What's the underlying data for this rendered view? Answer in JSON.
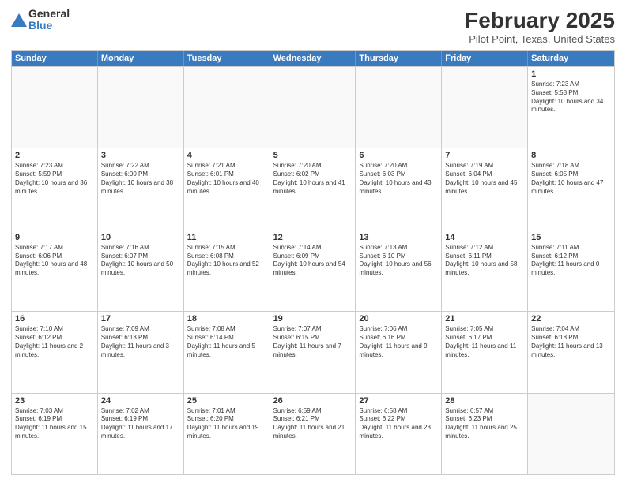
{
  "header": {
    "logo_general": "General",
    "logo_blue": "Blue",
    "month": "February 2025",
    "location": "Pilot Point, Texas, United States"
  },
  "weekdays": [
    "Sunday",
    "Monday",
    "Tuesday",
    "Wednesday",
    "Thursday",
    "Friday",
    "Saturday"
  ],
  "weeks": [
    [
      {
        "day": "",
        "text": ""
      },
      {
        "day": "",
        "text": ""
      },
      {
        "day": "",
        "text": ""
      },
      {
        "day": "",
        "text": ""
      },
      {
        "day": "",
        "text": ""
      },
      {
        "day": "",
        "text": ""
      },
      {
        "day": "1",
        "text": "Sunrise: 7:23 AM\nSunset: 5:58 PM\nDaylight: 10 hours and 34 minutes."
      }
    ],
    [
      {
        "day": "2",
        "text": "Sunrise: 7:23 AM\nSunset: 5:59 PM\nDaylight: 10 hours and 36 minutes."
      },
      {
        "day": "3",
        "text": "Sunrise: 7:22 AM\nSunset: 6:00 PM\nDaylight: 10 hours and 38 minutes."
      },
      {
        "day": "4",
        "text": "Sunrise: 7:21 AM\nSunset: 6:01 PM\nDaylight: 10 hours and 40 minutes."
      },
      {
        "day": "5",
        "text": "Sunrise: 7:20 AM\nSunset: 6:02 PM\nDaylight: 10 hours and 41 minutes."
      },
      {
        "day": "6",
        "text": "Sunrise: 7:20 AM\nSunset: 6:03 PM\nDaylight: 10 hours and 43 minutes."
      },
      {
        "day": "7",
        "text": "Sunrise: 7:19 AM\nSunset: 6:04 PM\nDaylight: 10 hours and 45 minutes."
      },
      {
        "day": "8",
        "text": "Sunrise: 7:18 AM\nSunset: 6:05 PM\nDaylight: 10 hours and 47 minutes."
      }
    ],
    [
      {
        "day": "9",
        "text": "Sunrise: 7:17 AM\nSunset: 6:06 PM\nDaylight: 10 hours and 48 minutes."
      },
      {
        "day": "10",
        "text": "Sunrise: 7:16 AM\nSunset: 6:07 PM\nDaylight: 10 hours and 50 minutes."
      },
      {
        "day": "11",
        "text": "Sunrise: 7:15 AM\nSunset: 6:08 PM\nDaylight: 10 hours and 52 minutes."
      },
      {
        "day": "12",
        "text": "Sunrise: 7:14 AM\nSunset: 6:09 PM\nDaylight: 10 hours and 54 minutes."
      },
      {
        "day": "13",
        "text": "Sunrise: 7:13 AM\nSunset: 6:10 PM\nDaylight: 10 hours and 56 minutes."
      },
      {
        "day": "14",
        "text": "Sunrise: 7:12 AM\nSunset: 6:11 PM\nDaylight: 10 hours and 58 minutes."
      },
      {
        "day": "15",
        "text": "Sunrise: 7:11 AM\nSunset: 6:12 PM\nDaylight: 11 hours and 0 minutes."
      }
    ],
    [
      {
        "day": "16",
        "text": "Sunrise: 7:10 AM\nSunset: 6:12 PM\nDaylight: 11 hours and 2 minutes."
      },
      {
        "day": "17",
        "text": "Sunrise: 7:09 AM\nSunset: 6:13 PM\nDaylight: 11 hours and 3 minutes."
      },
      {
        "day": "18",
        "text": "Sunrise: 7:08 AM\nSunset: 6:14 PM\nDaylight: 11 hours and 5 minutes."
      },
      {
        "day": "19",
        "text": "Sunrise: 7:07 AM\nSunset: 6:15 PM\nDaylight: 11 hours and 7 minutes."
      },
      {
        "day": "20",
        "text": "Sunrise: 7:06 AM\nSunset: 6:16 PM\nDaylight: 11 hours and 9 minutes."
      },
      {
        "day": "21",
        "text": "Sunrise: 7:05 AM\nSunset: 6:17 PM\nDaylight: 11 hours and 11 minutes."
      },
      {
        "day": "22",
        "text": "Sunrise: 7:04 AM\nSunset: 6:18 PM\nDaylight: 11 hours and 13 minutes."
      }
    ],
    [
      {
        "day": "23",
        "text": "Sunrise: 7:03 AM\nSunset: 6:19 PM\nDaylight: 11 hours and 15 minutes."
      },
      {
        "day": "24",
        "text": "Sunrise: 7:02 AM\nSunset: 6:19 PM\nDaylight: 11 hours and 17 minutes."
      },
      {
        "day": "25",
        "text": "Sunrise: 7:01 AM\nSunset: 6:20 PM\nDaylight: 11 hours and 19 minutes."
      },
      {
        "day": "26",
        "text": "Sunrise: 6:59 AM\nSunset: 6:21 PM\nDaylight: 11 hours and 21 minutes."
      },
      {
        "day": "27",
        "text": "Sunrise: 6:58 AM\nSunset: 6:22 PM\nDaylight: 11 hours and 23 minutes."
      },
      {
        "day": "28",
        "text": "Sunrise: 6:57 AM\nSunset: 6:23 PM\nDaylight: 11 hours and 25 minutes."
      },
      {
        "day": "",
        "text": ""
      }
    ]
  ]
}
